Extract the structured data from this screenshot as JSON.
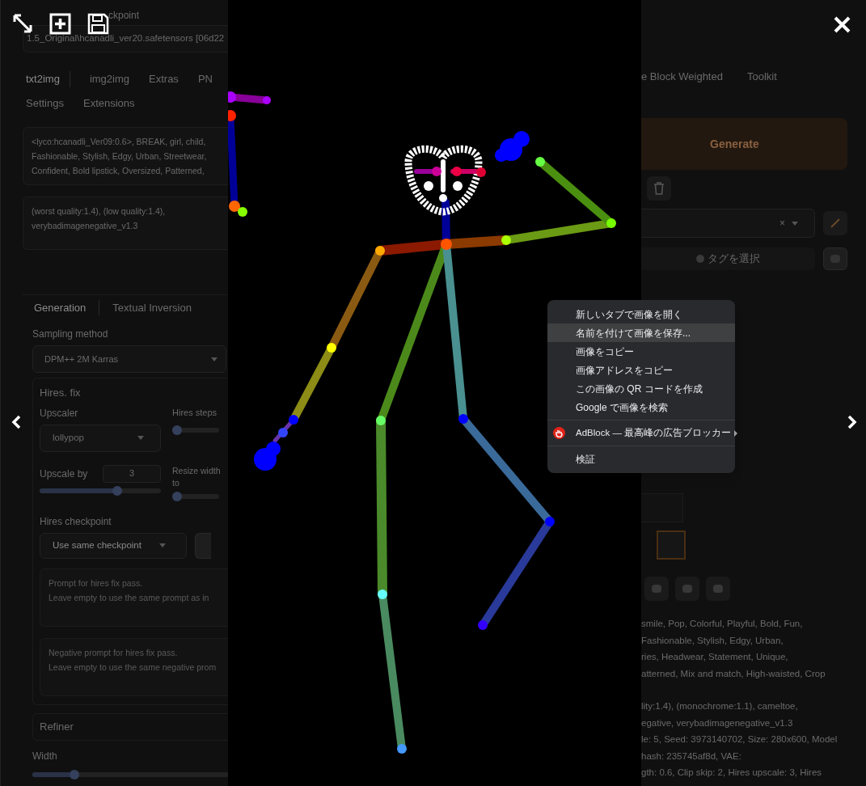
{
  "left_panel": {
    "checkpoint": {
      "label": "ckpoint",
      "value": "1.5_Original\\hcanadli_ver20.safetensors [06d22"
    },
    "tab_rows": [
      [
        {
          "label": "txt2img",
          "selected": true
        },
        {
          "label": "img2img",
          "selected": false
        },
        {
          "label": "Extras",
          "selected": false
        },
        {
          "label": "PN",
          "selected": false
        }
      ],
      [
        {
          "label": "Settings",
          "selected": false
        },
        {
          "label": "Extensions",
          "selected": false
        }
      ]
    ],
    "prompt": [
      "<lyco:hcanadli_Ver09:0.6>, BREAK, girl, child,",
      "Fashionable, Stylish, Edgy, Urban, Streetwear,",
      "Confident, Bold lipstick, Oversized, Patterned,"
    ],
    "negative_prompt": [
      "(worst quality:1.4), (low quality:1.4),",
      "verybadimagenegative_v1.3"
    ],
    "sub_tabs": [
      {
        "label": "Generation",
        "selected": true
      },
      {
        "label": "Textual Inversion",
        "selected": false
      }
    ],
    "sampling": {
      "label": "Sampling method",
      "value": "DPM++ 2M Karras"
    },
    "hires_fix": {
      "title": "Hires. fix",
      "upscaler": {
        "label": "Upscaler",
        "value": "lollypop"
      },
      "hires_steps": {
        "label": "Hires steps",
        "level": 0
      },
      "upscale_by": {
        "label": "Upscale by",
        "value": "3",
        "level": 0.65
      },
      "resize_width": {
        "label": "Resize width to",
        "level": 0
      },
      "hires_checkpoint": {
        "label": "Hires checkpoint",
        "value": "Use same checkpoint"
      },
      "hires_prompt": {
        "placeholder": "Prompt for hires fix pass.\nLeave empty to use the same prompt as in"
      },
      "hires_negative_prompt": {
        "placeholder": "Negative prompt for hires fix pass.\nLeave empty to use the same negative prom"
      }
    },
    "refiner": {
      "title": "Refiner"
    },
    "width": {
      "label": "Width",
      "level": 0.2
    }
  },
  "right_panel": {
    "tabs": [
      {
        "label": "e Block Weighted",
        "selected": false
      },
      {
        "label": "Toolkit",
        "selected": false
      }
    ],
    "generate_button": "Generate",
    "clear_icon": "×",
    "tag_button": "タグを選択",
    "thumbnail": {
      "selected": true
    },
    "info": [
      [
        "smile, Pop, Colorful, Playful, Bold, Fun,",
        "Fashionable, Stylish, Edgy, Urban,",
        "ries, Headwear, Statement, Unique,",
        "atterned, Mix and match, High-waisted, Crop"
      ],
      [
        "lity:1.4), (monochrome:1.1), cameltoe,",
        "egative, verybadimagenegative_v1.3",
        "le: 5, Seed: 3973140702, Size: 280x600, Model",
        "hash: 235745af8d, VAE:",
        "gth: 0.6, Clip skip: 2, Hires upscale: 3, Hires"
      ]
    ]
  },
  "context_menu": {
    "groups": [
      [
        {
          "kind": "item",
          "label": "新しいタブで画像を開く",
          "selected": false
        },
        {
          "kind": "item",
          "label": "名前を付けて画像を保存...",
          "selected": true
        },
        {
          "kind": "item",
          "label": "画像をコピー",
          "selected": false
        },
        {
          "kind": "item",
          "label": "画像アドレスをコピー",
          "selected": false
        },
        {
          "kind": "item",
          "label": "この画像の QR コードを作成",
          "selected": false
        },
        {
          "kind": "item",
          "label": "Google で画像を検索",
          "selected": false
        }
      ],
      [
        {
          "kind": "extension",
          "label": "AdBlock — 最高峰の広告ブロッカー",
          "selected": false
        }
      ],
      [
        {
          "kind": "item",
          "label": "検証",
          "selected": false
        }
      ]
    ]
  }
}
